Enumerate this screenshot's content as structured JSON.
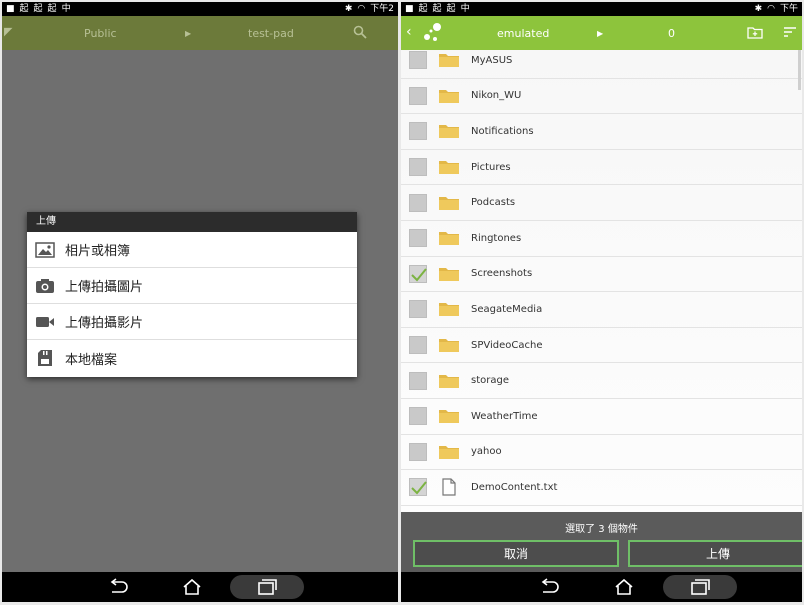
{
  "left_screen": {
    "status": {
      "left_icons": [
        "起",
        "起",
        "起",
        "中",
        "■"
      ],
      "time_text": "下午2"
    },
    "toolbar": {
      "crumb_1": "Public",
      "crumb_2": "test-pad"
    },
    "dialog": {
      "title": "上傳",
      "items": [
        {
          "label": "相片或相簿",
          "icon": "image-icon"
        },
        {
          "label": "上傳拍攝圖片",
          "icon": "camera-icon"
        },
        {
          "label": "上傳拍攝影片",
          "icon": "video-camera-icon"
        },
        {
          "label": "本地檔案",
          "icon": "sd-card-icon"
        }
      ]
    }
  },
  "right_screen": {
    "status": {
      "time_text": "下午"
    },
    "toolbar": {
      "path": "emulated",
      "count": "0"
    },
    "files": [
      {
        "name": "MyASUS",
        "type": "folder",
        "checked": false
      },
      {
        "name": "Nikon_WU",
        "type": "folder",
        "checked": false
      },
      {
        "name": "Notifications",
        "type": "folder",
        "checked": false
      },
      {
        "name": "Pictures",
        "type": "folder",
        "checked": false
      },
      {
        "name": "Podcasts",
        "type": "folder",
        "checked": false
      },
      {
        "name": "Ringtones",
        "type": "folder",
        "checked": false
      },
      {
        "name": "Screenshots",
        "type": "folder",
        "checked": true
      },
      {
        "name": "SeagateMedia",
        "type": "folder",
        "checked": false
      },
      {
        "name": "SPVideoCache",
        "type": "folder",
        "checked": false
      },
      {
        "name": "storage",
        "type": "folder",
        "checked": false
      },
      {
        "name": "WeatherTime",
        "type": "folder",
        "checked": false
      },
      {
        "name": "yahoo",
        "type": "folder",
        "checked": false
      },
      {
        "name": "DemoContent.txt",
        "type": "file",
        "checked": true
      }
    ],
    "bottom": {
      "selection_text": "選取了 3 個物件",
      "cancel_label": "取消",
      "upload_label": "上傳"
    }
  },
  "colors": {
    "accent_green": "#8dc43c",
    "dim_toolbar": "#6c7a3a",
    "folder_yellow": "#e3b848",
    "check_green": "#7cb342"
  }
}
